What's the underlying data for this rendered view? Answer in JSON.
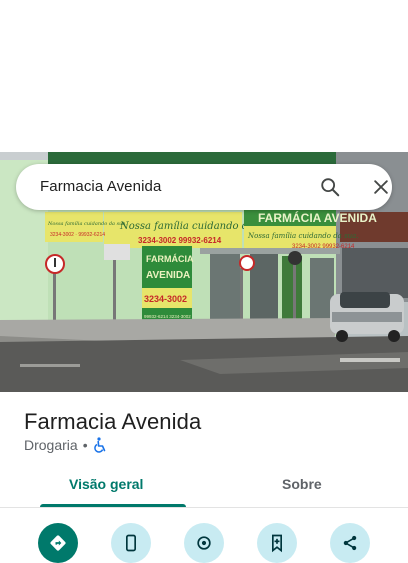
{
  "search": {
    "query": "Farmacia Avenida"
  },
  "storefront": {
    "sign_name_line1": "FARMÁCIA",
    "sign_name_line2": "AVENIDA",
    "sign_phone": "3234-3002",
    "banner_slogan": "Nossa família cuidando da sua.",
    "banner_phones": "3234-3002  99932-6214",
    "small_banner_slogan": "Nossa família cuidando da sua.",
    "small_banner_phones": "3234-3002 · 99932-6214",
    "right_banner_text": "FARMÁCIA AVENIDA",
    "right_banner_slogan": "Nossa família cuidando da sua.",
    "right_banner_phones": "3234-3002  99932-6214",
    "sign_small_phones": "99932-6214  3234-3002"
  },
  "place": {
    "title": "Farmacia Avenida",
    "category": "Drogaria",
    "separator": "•"
  },
  "tabs": [
    {
      "label": "Visão geral",
      "active": true
    },
    {
      "label": "Sobre",
      "active": false
    }
  ],
  "actions": [
    {
      "icon": "directions-icon",
      "style": "primary"
    },
    {
      "icon": "phone-icon",
      "style": "secondary"
    },
    {
      "icon": "location-icon",
      "style": "secondary"
    },
    {
      "icon": "save-icon",
      "style": "secondary"
    },
    {
      "icon": "share-icon",
      "style": "secondary"
    }
  ],
  "colors": {
    "accent": "#00796b",
    "action_secondary_bg": "#c8ebf2",
    "sign_green": "#2e8b3a",
    "banner_yellow": "#e7e56a",
    "building_green": "#bfe0b7"
  }
}
